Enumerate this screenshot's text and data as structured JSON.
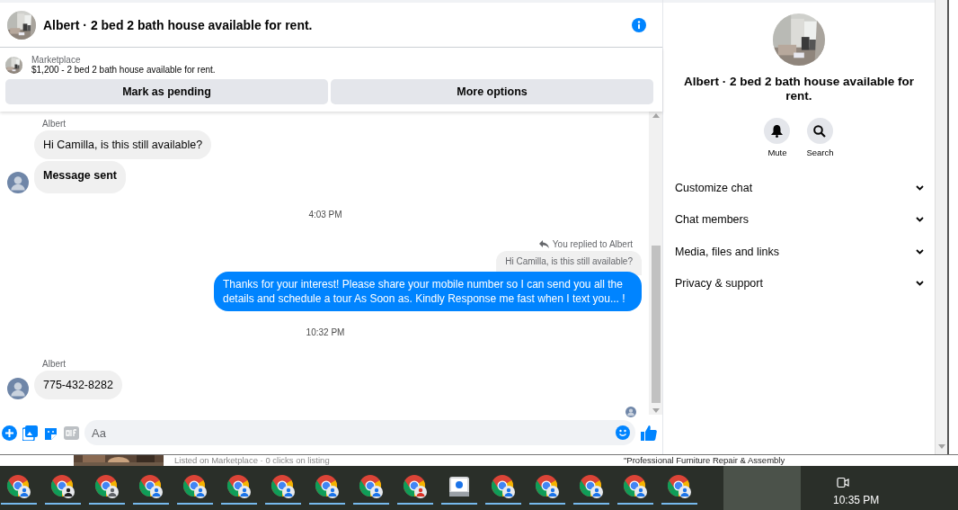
{
  "conversation": {
    "title": "Albert · 2 bed 2 bath house available for rent.",
    "listing": {
      "source": "Marketplace",
      "summary": "$1,200 - 2 bed 2 bath house available for rent."
    },
    "actions": [
      "Mark as pending",
      "More options"
    ],
    "messages": [
      {
        "kind": "sender",
        "text": "Albert"
      },
      {
        "kind": "incoming",
        "text": "Hi Camilla, is this still available?",
        "avatar": false
      },
      {
        "kind": "notice",
        "text": "Message sent",
        "avatar": true
      },
      {
        "kind": "time",
        "text": "4:03 PM"
      },
      {
        "kind": "reply-note",
        "text": "You replied to Albert"
      },
      {
        "kind": "quote",
        "text": "Hi Camilla, is this still available?"
      },
      {
        "kind": "outgoing",
        "text": "Thanks for your interest! Please share your mobile number so I can send you all the details and schedule a tour As Soon as. Kindly Response me fast when I text you... !"
      },
      {
        "kind": "time",
        "text": "10:32 PM"
      },
      {
        "kind": "sender",
        "text": "Albert"
      },
      {
        "kind": "incoming",
        "text": "775-432-8282",
        "avatar": true
      },
      {
        "kind": "seen"
      }
    ],
    "composer": {
      "placeholder": "Aa"
    }
  },
  "panel": {
    "title": "Albert · 2 bed 2 bath house available for rent.",
    "actions": [
      {
        "kind": "mute",
        "label": "Mute"
      },
      {
        "kind": "search",
        "label": "Search"
      }
    ],
    "sections": [
      {
        "label": "Customize chat",
        "expanded": false
      },
      {
        "label": "Chat members",
        "expanded": false
      },
      {
        "label": "Media, files and links",
        "expanded": false
      },
      {
        "label": "Privacy & support",
        "expanded": false
      }
    ]
  },
  "background": {
    "texts": [
      "Listed on Marketplace · 0 clicks on listing",
      "\"Professional Furniture Repair & Assembly"
    ]
  },
  "taskbar": {
    "apps": [
      {
        "kind": "browser",
        "color": "#1a73e8"
      },
      {
        "kind": "browser",
        "color": "#202124"
      },
      {
        "kind": "browser",
        "color": "#5f6368"
      },
      {
        "kind": "browser",
        "color": "#1a73e8"
      },
      {
        "kind": "browser",
        "color": "#1a73e8"
      },
      {
        "kind": "browser",
        "color": "#1a73e8"
      },
      {
        "kind": "browser",
        "color": "#1a73e8"
      },
      {
        "kind": "browser",
        "color": "#1a73e8"
      },
      {
        "kind": "browser",
        "color": "#1a73e8"
      },
      {
        "kind": "browser",
        "color": "#d93025"
      },
      {
        "kind": "app",
        "color": "#1a73e8"
      },
      {
        "kind": "browser",
        "color": "#1a73e8"
      },
      {
        "kind": "browser",
        "color": "#1a73e8"
      },
      {
        "kind": "browser",
        "color": "#1a73e8"
      },
      {
        "kind": "browser",
        "color": "#1a73e8"
      },
      {
        "kind": "browser",
        "color": "#1a73e8"
      }
    ],
    "time": "10:35 PM"
  }
}
